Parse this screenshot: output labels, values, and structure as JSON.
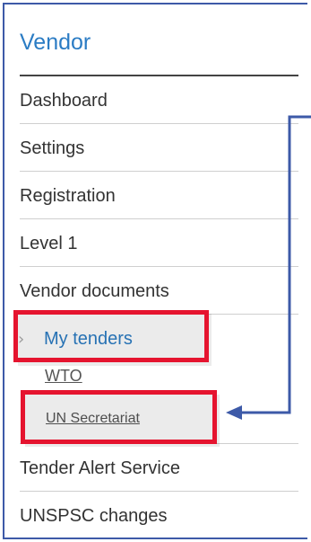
{
  "sidebar": {
    "title": "Vendor",
    "items": [
      {
        "label": "Dashboard"
      },
      {
        "label": "Settings"
      },
      {
        "label": "Registration"
      },
      {
        "label": "Level 1"
      },
      {
        "label": "Vendor documents"
      },
      {
        "label": "My tenders"
      },
      {
        "label": "WTO"
      },
      {
        "label": "UN Secretariat"
      },
      {
        "label": "Tender Alert Service"
      },
      {
        "label": "UNSPSC changes"
      }
    ]
  },
  "icons": {
    "active_chevron": "›"
  },
  "colors": {
    "accent": "#2b7cc4",
    "frame": "#3d5aa8",
    "highlight": "#e5142f",
    "arrow": "#3d5aa8",
    "text": "#333333"
  }
}
